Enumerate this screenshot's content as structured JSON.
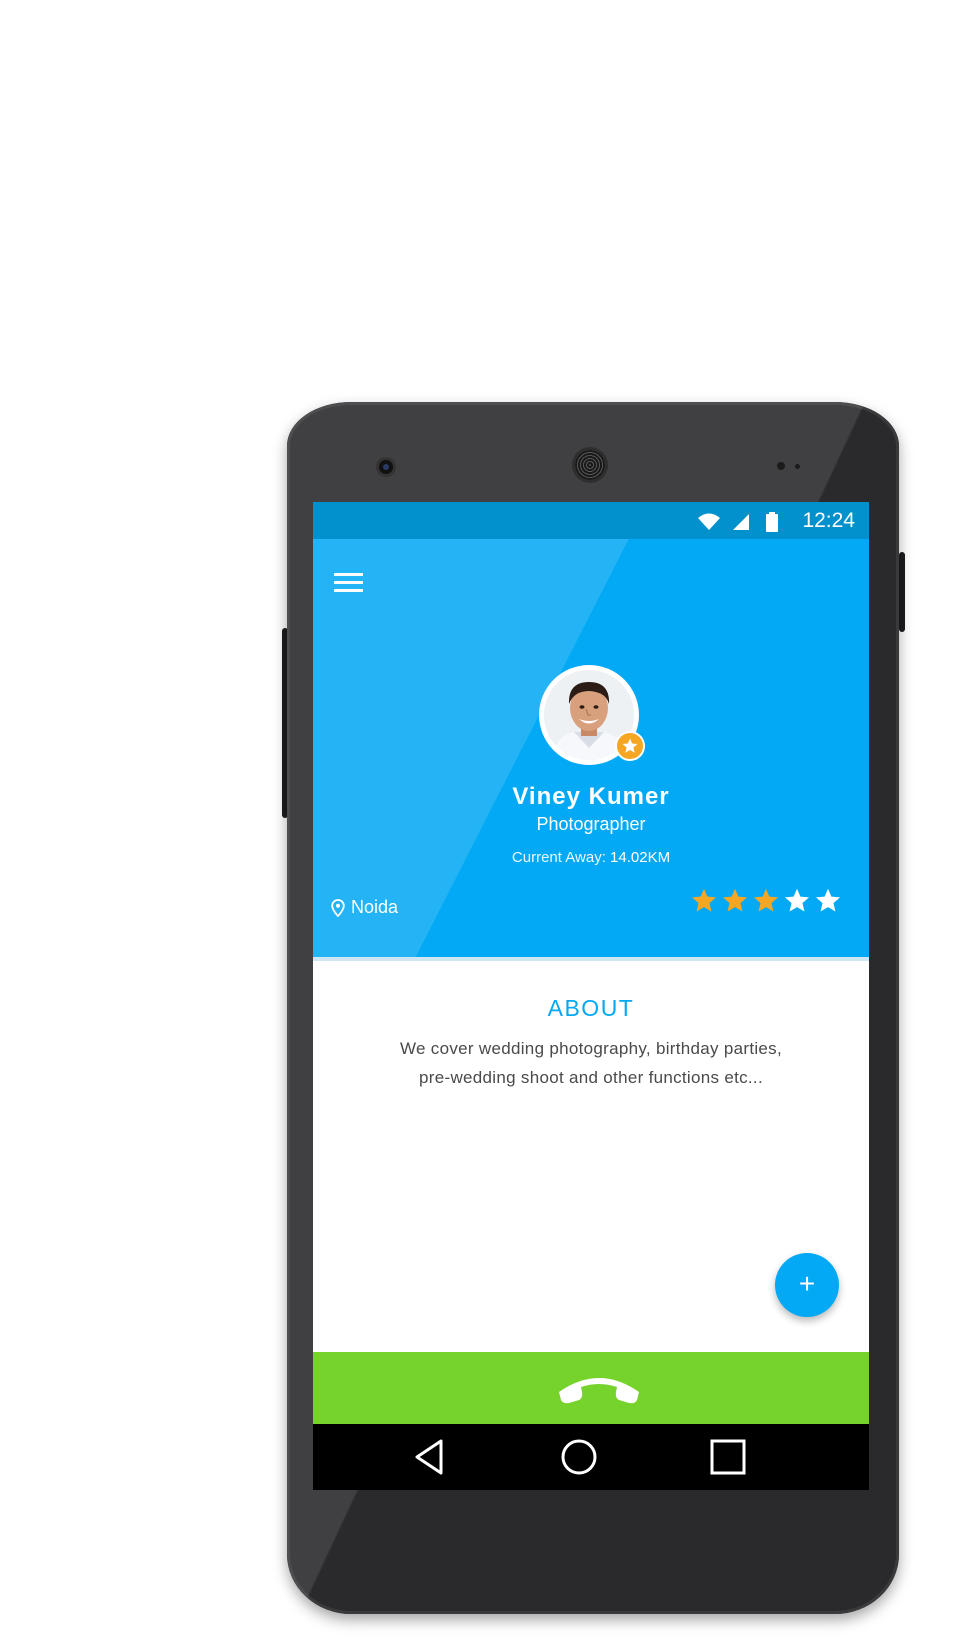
{
  "status_bar": {
    "time": "12:24",
    "icons": [
      "wifi-icon",
      "signal-icon",
      "battery-icon"
    ]
  },
  "header": {
    "menu_icon": "hamburger-menu-icon",
    "background": "#03a9f4"
  },
  "profile": {
    "name": "Viney Kumer",
    "role": "Photographer",
    "distance_label": "Current Away:",
    "distance_value": "14.02KM",
    "location": "Noida",
    "rating": 3,
    "rating_max": 5,
    "badge_icon": "star-badge-icon"
  },
  "about": {
    "title": "ABOUT",
    "text": "We cover wedding photography, birthday parties, pre-wedding shoot and other functions etc..."
  },
  "fab": {
    "label": "+"
  },
  "call": {
    "icon": "phone-hangup-icon",
    "color": "#76d32b"
  },
  "nav": {
    "icons": [
      "back-icon",
      "home-icon",
      "recents-icon"
    ]
  },
  "colors": {
    "accent": "#03a9f4",
    "star_filled": "#f5a623",
    "star_empty": "#ffffff"
  }
}
